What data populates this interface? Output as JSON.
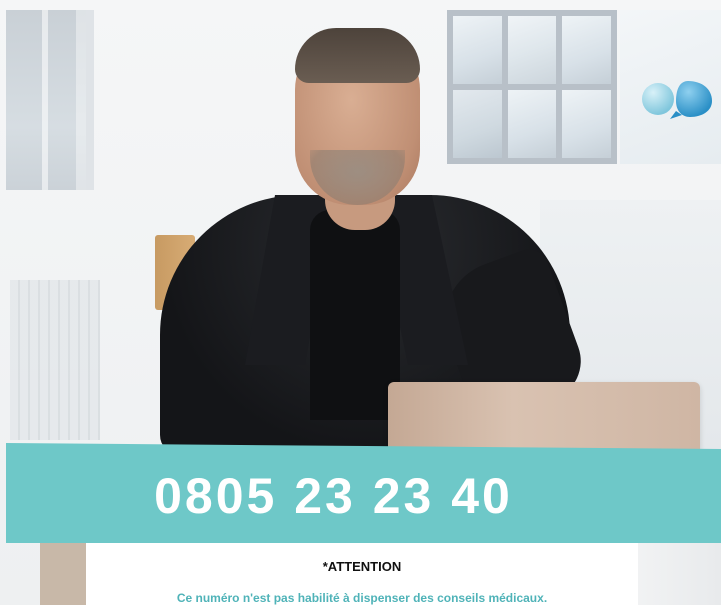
{
  "banner": {
    "phone_number": "0805 23 23 40"
  },
  "notice": {
    "title": "*ATTENTION",
    "text": "Ce numéro n'est pas habilité à dispenser des conseils médicaux."
  },
  "logo": {
    "icon": "bubbles-logo-icon"
  },
  "colors": {
    "banner_bg": "#6ec8c8",
    "phone_text": "#ffffff",
    "notice_text": "#4fb3b8",
    "bubble_light": "#8fd3e6",
    "bubble_dark": "#2f9fd0"
  }
}
